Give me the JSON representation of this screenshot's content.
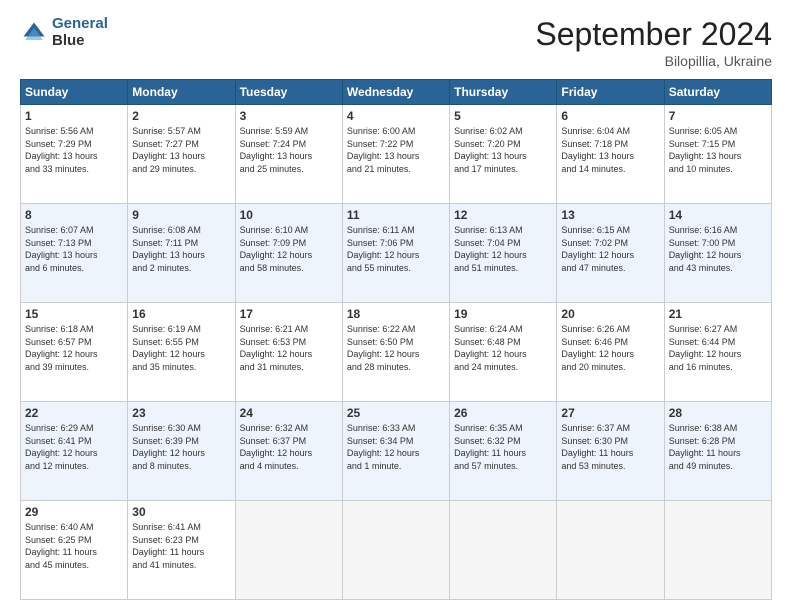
{
  "header": {
    "logo_line1": "General",
    "logo_line2": "Blue",
    "month": "September 2024",
    "location": "Bilopillia, Ukraine"
  },
  "weekdays": [
    "Sunday",
    "Monday",
    "Tuesday",
    "Wednesday",
    "Thursday",
    "Friday",
    "Saturday"
  ],
  "weeks": [
    [
      {
        "day": "1",
        "info": "Sunrise: 5:56 AM\nSunset: 7:29 PM\nDaylight: 13 hours\nand 33 minutes."
      },
      {
        "day": "2",
        "info": "Sunrise: 5:57 AM\nSunset: 7:27 PM\nDaylight: 13 hours\nand 29 minutes."
      },
      {
        "day": "3",
        "info": "Sunrise: 5:59 AM\nSunset: 7:24 PM\nDaylight: 13 hours\nand 25 minutes."
      },
      {
        "day": "4",
        "info": "Sunrise: 6:00 AM\nSunset: 7:22 PM\nDaylight: 13 hours\nand 21 minutes."
      },
      {
        "day": "5",
        "info": "Sunrise: 6:02 AM\nSunset: 7:20 PM\nDaylight: 13 hours\nand 17 minutes."
      },
      {
        "day": "6",
        "info": "Sunrise: 6:04 AM\nSunset: 7:18 PM\nDaylight: 13 hours\nand 14 minutes."
      },
      {
        "day": "7",
        "info": "Sunrise: 6:05 AM\nSunset: 7:15 PM\nDaylight: 13 hours\nand 10 minutes."
      }
    ],
    [
      {
        "day": "8",
        "info": "Sunrise: 6:07 AM\nSunset: 7:13 PM\nDaylight: 13 hours\nand 6 minutes."
      },
      {
        "day": "9",
        "info": "Sunrise: 6:08 AM\nSunset: 7:11 PM\nDaylight: 13 hours\nand 2 minutes."
      },
      {
        "day": "10",
        "info": "Sunrise: 6:10 AM\nSunset: 7:09 PM\nDaylight: 12 hours\nand 58 minutes."
      },
      {
        "day": "11",
        "info": "Sunrise: 6:11 AM\nSunset: 7:06 PM\nDaylight: 12 hours\nand 55 minutes."
      },
      {
        "day": "12",
        "info": "Sunrise: 6:13 AM\nSunset: 7:04 PM\nDaylight: 12 hours\nand 51 minutes."
      },
      {
        "day": "13",
        "info": "Sunrise: 6:15 AM\nSunset: 7:02 PM\nDaylight: 12 hours\nand 47 minutes."
      },
      {
        "day": "14",
        "info": "Sunrise: 6:16 AM\nSunset: 7:00 PM\nDaylight: 12 hours\nand 43 minutes."
      }
    ],
    [
      {
        "day": "15",
        "info": "Sunrise: 6:18 AM\nSunset: 6:57 PM\nDaylight: 12 hours\nand 39 minutes."
      },
      {
        "day": "16",
        "info": "Sunrise: 6:19 AM\nSunset: 6:55 PM\nDaylight: 12 hours\nand 35 minutes."
      },
      {
        "day": "17",
        "info": "Sunrise: 6:21 AM\nSunset: 6:53 PM\nDaylight: 12 hours\nand 31 minutes."
      },
      {
        "day": "18",
        "info": "Sunrise: 6:22 AM\nSunset: 6:50 PM\nDaylight: 12 hours\nand 28 minutes."
      },
      {
        "day": "19",
        "info": "Sunrise: 6:24 AM\nSunset: 6:48 PM\nDaylight: 12 hours\nand 24 minutes."
      },
      {
        "day": "20",
        "info": "Sunrise: 6:26 AM\nSunset: 6:46 PM\nDaylight: 12 hours\nand 20 minutes."
      },
      {
        "day": "21",
        "info": "Sunrise: 6:27 AM\nSunset: 6:44 PM\nDaylight: 12 hours\nand 16 minutes."
      }
    ],
    [
      {
        "day": "22",
        "info": "Sunrise: 6:29 AM\nSunset: 6:41 PM\nDaylight: 12 hours\nand 12 minutes."
      },
      {
        "day": "23",
        "info": "Sunrise: 6:30 AM\nSunset: 6:39 PM\nDaylight: 12 hours\nand 8 minutes."
      },
      {
        "day": "24",
        "info": "Sunrise: 6:32 AM\nSunset: 6:37 PM\nDaylight: 12 hours\nand 4 minutes."
      },
      {
        "day": "25",
        "info": "Sunrise: 6:33 AM\nSunset: 6:34 PM\nDaylight: 12 hours\nand 1 minute."
      },
      {
        "day": "26",
        "info": "Sunrise: 6:35 AM\nSunset: 6:32 PM\nDaylight: 11 hours\nand 57 minutes."
      },
      {
        "day": "27",
        "info": "Sunrise: 6:37 AM\nSunset: 6:30 PM\nDaylight: 11 hours\nand 53 minutes."
      },
      {
        "day": "28",
        "info": "Sunrise: 6:38 AM\nSunset: 6:28 PM\nDaylight: 11 hours\nand 49 minutes."
      }
    ],
    [
      {
        "day": "29",
        "info": "Sunrise: 6:40 AM\nSunset: 6:25 PM\nDaylight: 11 hours\nand 45 minutes."
      },
      {
        "day": "30",
        "info": "Sunrise: 6:41 AM\nSunset: 6:23 PM\nDaylight: 11 hours\nand 41 minutes."
      },
      {
        "day": "",
        "info": ""
      },
      {
        "day": "",
        "info": ""
      },
      {
        "day": "",
        "info": ""
      },
      {
        "day": "",
        "info": ""
      },
      {
        "day": "",
        "info": ""
      }
    ]
  ]
}
